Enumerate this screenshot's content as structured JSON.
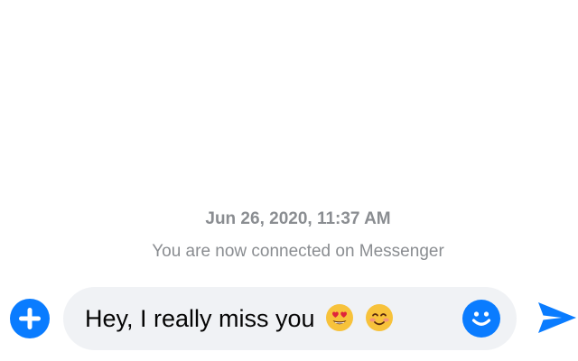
{
  "conversation": {
    "timestamp": "Jun 26, 2020, 11:37 AM",
    "system_message": "You are now connected on Messenger"
  },
  "composer": {
    "message_text": "Hey, I really miss you",
    "emojis": [
      "heart-eyes-emoji",
      "blushing-smile-emoji"
    ],
    "add_icon": "plus-circle-icon",
    "emoji_icon": "smiley-icon",
    "send_icon": "send-arrow-icon"
  },
  "colors": {
    "accent": "#0a7cff",
    "input_background": "#f0f2f5",
    "meta_text": "#8a8d91",
    "message_text": "#050505"
  }
}
